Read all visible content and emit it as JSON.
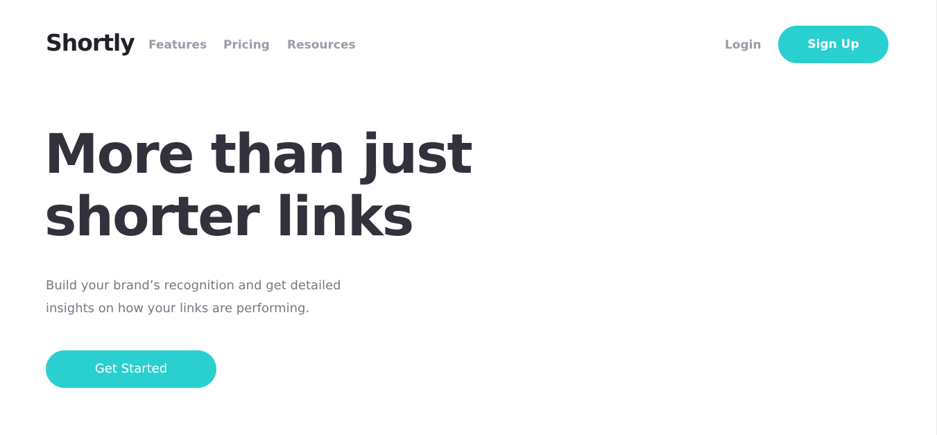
{
  "header": {
    "logo": "Shortly",
    "nav": {
      "features": "Features",
      "pricing": "Pricing",
      "resources": "Resources"
    },
    "login": "Login",
    "signup": "Sign Up"
  },
  "hero": {
    "title": "More than just shorter links",
    "subtitle": "Build your brand’s recognition and get detailed insights on how your links are performing.",
    "cta": "Get Started"
  },
  "colors": {
    "accent": "#2acfcf",
    "heading": "#34313d",
    "nav_text": "#9e9aa7",
    "body_text": "#7c7785"
  }
}
